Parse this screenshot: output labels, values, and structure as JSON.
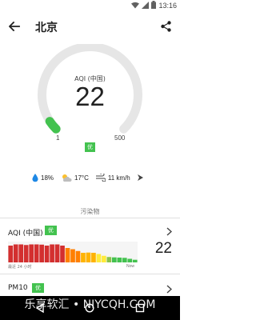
{
  "status_bar": {
    "time": "13:16",
    "icons": [
      "wifi-icon",
      "signal-icon",
      "battery-icon"
    ]
  },
  "app_bar": {
    "title": "北京",
    "back_icon": "arrow-back-icon",
    "share_icon": "share-icon"
  },
  "gauge": {
    "label": "AQI (中国)",
    "value": "22",
    "min": "1",
    "max": "500",
    "level": "优",
    "level_color": "#43c24f",
    "fraction": 0.044
  },
  "weather": {
    "humidity": "18%",
    "temperature": "17°C",
    "wind": "11 km/h"
  },
  "section": {
    "title": "污染物"
  },
  "pollutants": [
    {
      "name": "AQI (中国)",
      "level": "优",
      "value": "22",
      "axis_left": "最近 24 小时",
      "axis_right": "Now",
      "bars": [
        140,
        150,
        150,
        145,
        150,
        150,
        148,
        140,
        150,
        150,
        140,
        120,
        110,
        95,
        80,
        82,
        80,
        70,
        55,
        45,
        42,
        40,
        38,
        30,
        22
      ],
      "bar_colors": [
        "#d32f2f",
        "#d32f2f",
        "#d32f2f",
        "#d32f2f",
        "#d32f2f",
        "#d32f2f",
        "#d32f2f",
        "#d32f2f",
        "#d32f2f",
        "#d32f2f",
        "#d32f2f",
        "#ff7f00",
        "#ff7f00",
        "#ff7f00",
        "#ffb300",
        "#ffb300",
        "#ffb300",
        "#ffeb3b",
        "#ffeb3b",
        "#8bc34a",
        "#43c24f",
        "#43c24f",
        "#43c24f",
        "#43c24f",
        "#43c24f"
      ]
    },
    {
      "name": "PM10",
      "level": "优"
    }
  ],
  "nav": {
    "back_icon": "nav-back-icon",
    "home_icon": "nav-home-icon",
    "recents_icon": "nav-recents-icon"
  },
  "watermark": "乐享软汇 • NIYCQH.COM"
}
